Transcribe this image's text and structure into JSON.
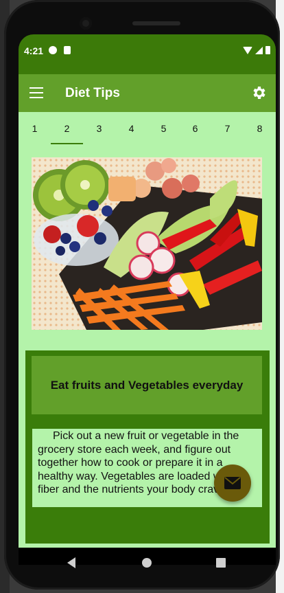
{
  "status_bar": {
    "time": "4:21"
  },
  "app_bar": {
    "title": "Diet Tips",
    "menu_icon": "hamburger-menu-icon",
    "settings_icon": "gear-icon"
  },
  "tabs": {
    "items": [
      "1",
      "2",
      "3",
      "4",
      "5",
      "6",
      "7",
      "8"
    ],
    "selected": "2"
  },
  "card": {
    "title": "Eat fruits and Vegetables everyday",
    "body": "Pick out a new fruit or vegetable in the grocery store each week, and figure out together how to cook or prepare it in a healthy way. Vegetables are loaded with fiber and the nutrients your body craves."
  },
  "fab": {
    "icon": "mail-icon"
  },
  "colors": {
    "status_bar": "#3c7a09",
    "app_bar": "#62a02a",
    "background": "#b4f3aa",
    "card_border": "#3a7d0a",
    "fab": "#6a5a0a"
  }
}
